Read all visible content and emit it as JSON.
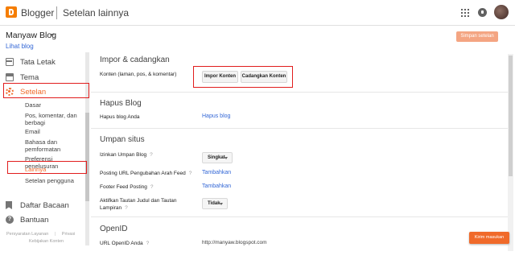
{
  "header": {
    "brand": "Blogger",
    "page_title": "Setelan lainnya",
    "icons": [
      "apps-icon",
      "notifications-icon",
      "avatar"
    ]
  },
  "blog": {
    "name": "Manyaw Blog",
    "view_link": "Lihat blog",
    "save_button": "Simpan setelan"
  },
  "sidebar": {
    "items": [
      {
        "label": "Tata Letak",
        "icon": "layout-icon"
      },
      {
        "label": "Tema",
        "icon": "theme-icon"
      },
      {
        "label": "Setelan",
        "icon": "gear-icon",
        "active": true
      },
      {
        "label": "Daftar Bacaan",
        "icon": "bookmark-icon"
      },
      {
        "label": "Bantuan",
        "icon": "help-icon"
      }
    ],
    "sub_items": [
      "Dasar",
      "Pos, komentar, dan berbagi",
      "Email",
      "Bahasa dan pemformatan",
      "Preferensi penelusuran",
      "Lainnya",
      "Setelan pengguna"
    ],
    "footer": {
      "terms": "Persyaratan Layanan",
      "privacy": "Privasi",
      "content_policy": "Kebijakan Konten"
    }
  },
  "main": {
    "import_backup": {
      "title": "Impor & cadangkan",
      "label": "Konten (laman, pos, & komentar)",
      "import_button": "Impor Konten",
      "backup_button": "Cadangkan Konten"
    },
    "delete_blog": {
      "title": "Hapus Blog",
      "label": "Hapus blog Anda",
      "link": "Hapus blog"
    },
    "feed": {
      "title": "Umpan situs",
      "rows": [
        {
          "label": "Izinkan Umpan Blog",
          "hint": "?",
          "value": "Singkat"
        },
        {
          "label": "Posting URL Pengubahan Arah Feed",
          "hint": "?",
          "value": "Tambahkan"
        },
        {
          "label": "Footer Feed Posting",
          "hint": "?",
          "value": "Tambahkan"
        },
        {
          "label": "Aktifkan Tautan Judul dan Tautan Lampiran",
          "hint": "?",
          "value": "Tidak"
        }
      ]
    },
    "openid": {
      "title": "OpenID",
      "label": "URL OpenID Anda",
      "hint": "?",
      "value": "http://manyaw.blogspot.com"
    }
  },
  "feedback_button": "Kirim masukan",
  "colors": {
    "accent": "#f06a2a",
    "link": "#3367d6",
    "highlight": "#e11d1d"
  }
}
